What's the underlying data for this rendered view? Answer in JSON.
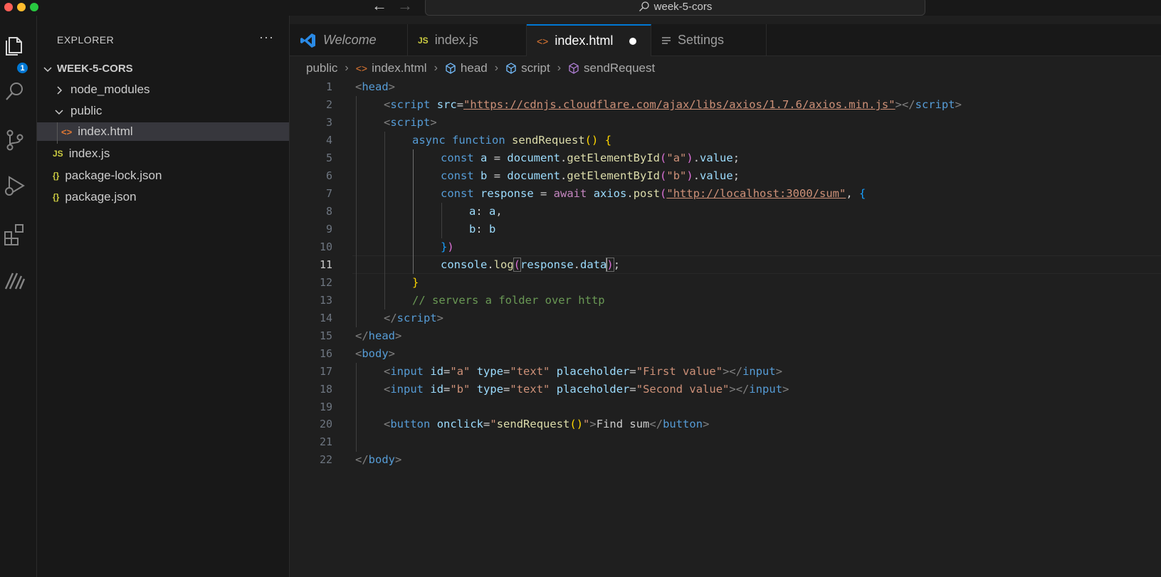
{
  "titlebar": {
    "search_text": "week-5-cors",
    "back_icon": "arrow-left-icon",
    "forward_icon": "arrow-right-icon"
  },
  "activity_bar": {
    "explorer_badge": "1",
    "icons": [
      "files-icon",
      "search-icon",
      "source-control-icon",
      "run-debug-icon",
      "extensions-icon",
      "custom-extension-icon"
    ]
  },
  "sidebar": {
    "title": "EXPLORER",
    "more_label": "···",
    "root_folder": "WEEK-5-CORS",
    "items": [
      {
        "label": "node_modules",
        "type": "folder-collapsed"
      },
      {
        "label": "public",
        "type": "folder-expanded"
      },
      {
        "label": "index.html",
        "type": "html",
        "selected": true
      },
      {
        "label": "index.js",
        "type": "js"
      },
      {
        "label": "package-lock.json",
        "type": "json"
      },
      {
        "label": "package.json",
        "type": "json"
      }
    ],
    "icon_labels": {
      "js": "JS",
      "json": "{}",
      "html": "<>"
    }
  },
  "tabs": [
    {
      "label": "Welcome",
      "icon": "vscode-logo-icon"
    },
    {
      "label": "index.js",
      "icon": "js-file-icon",
      "icon_text": "JS"
    },
    {
      "label": "index.html",
      "icon": "html-file-icon",
      "icon_text": "<>",
      "active": true,
      "modified": true
    },
    {
      "label": "Settings",
      "icon": "settings-list-icon"
    }
  ],
  "breadcrumbs": [
    "public",
    "index.html",
    "head",
    "script",
    "sendRequest"
  ],
  "editor": {
    "active_line": 11,
    "line_numbers": [
      "1",
      "2",
      "3",
      "4",
      "5",
      "6",
      "7",
      "8",
      "9",
      "10",
      "11",
      "12",
      "13",
      "14",
      "15",
      "16",
      "17",
      "18",
      "19",
      "20",
      "21",
      "22"
    ],
    "tokens": {
      "l1": [
        "<",
        "head",
        ">"
      ],
      "l2": [
        "<",
        "script",
        " ",
        "src",
        "=",
        "\"https://cdnjs.cloudflare.com/ajax/libs/axios/1.7.6/axios.min.js\"",
        "></",
        "script",
        ">"
      ],
      "l3": [
        "<",
        "script",
        ">"
      ],
      "l4": [
        "async",
        " ",
        "function",
        " ",
        "sendRequest",
        "(",
        ")",
        " ",
        "{"
      ],
      "l5": [
        "const",
        " ",
        "a",
        " = ",
        "document",
        ".",
        "getElementById",
        "(",
        "\"a\"",
        ")",
        ".",
        "value",
        ";"
      ],
      "l6": [
        "const",
        " ",
        "b",
        " = ",
        "document",
        ".",
        "getElementById",
        "(",
        "\"b\"",
        ")",
        ".",
        "value",
        ";"
      ],
      "l7": [
        "const",
        " ",
        "response",
        " = ",
        "await",
        " ",
        "axios",
        ".",
        "post",
        "(",
        "\"http://localhost:3000/sum\"",
        ", ",
        "{"
      ],
      "l8": [
        "a",
        ": ",
        "a",
        ","
      ],
      "l9": [
        "b",
        ": ",
        "b"
      ],
      "l10": [
        "}",
        ")"
      ],
      "l11": [
        "console",
        ".",
        "log",
        "(",
        "response",
        ".",
        "data",
        ")",
        ";"
      ],
      "l12": [
        "}"
      ],
      "l13": [
        "// servers a folder over http"
      ],
      "l14": [
        "</",
        "script",
        ">"
      ],
      "l15": [
        "</",
        "head",
        ">"
      ],
      "l16": [
        "<",
        "body",
        ">"
      ],
      "l17": [
        "<",
        "input",
        " ",
        "id",
        "=",
        "\"a\"",
        " ",
        "type",
        "=",
        "\"text\"",
        " ",
        "placeholder",
        "=",
        "\"First value\"",
        "></",
        "input",
        ">"
      ],
      "l18": [
        "<",
        "input",
        " ",
        "id",
        "=",
        "\"b\"",
        " ",
        "type",
        "=",
        "\"text\"",
        " ",
        "placeholder",
        "=",
        "\"Second value\"",
        "></",
        "input",
        ">"
      ],
      "l20": [
        "<",
        "button",
        " ",
        "onclick",
        "=",
        "\"",
        "sendRequest",
        "(",
        ")",
        "\"",
        ">",
        "Find sum",
        "</",
        "button",
        ">"
      ],
      "l22": [
        "</",
        "body",
        ">"
      ]
    }
  }
}
